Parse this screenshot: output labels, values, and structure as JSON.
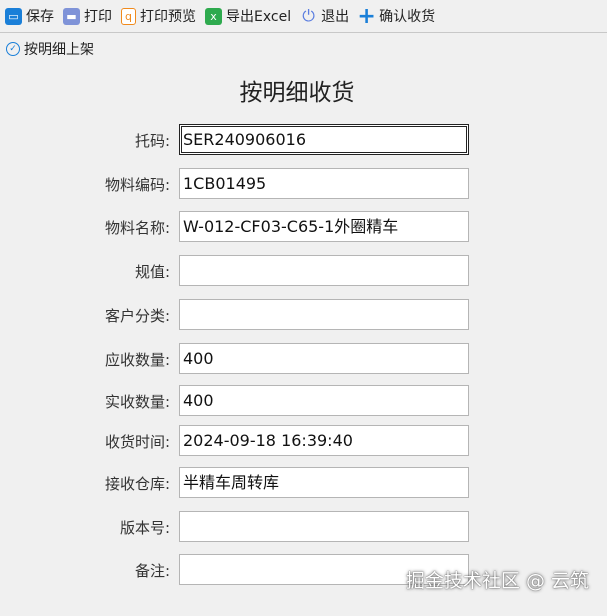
{
  "toolbar": {
    "save": "保存",
    "print": "打印",
    "preview": "打印预览",
    "export": "导出Excel",
    "exit": "退出",
    "confirm": "确认收货",
    "shelve": "按明细上架"
  },
  "title": "按明细收货",
  "fields": [
    {
      "label": "托码:",
      "value": "SER240906016"
    },
    {
      "label": "物料编码:",
      "value": "1CB01495"
    },
    {
      "label": "物料名称:",
      "value": "W-012-CF03-C65-1外圈精车"
    },
    {
      "label": "规值:",
      "value": ""
    },
    {
      "label": "客户分类:",
      "value": ""
    },
    {
      "label": "应收数量:",
      "value": "400"
    },
    {
      "label": "实收数量:",
      "value": "400"
    },
    {
      "label": "收货时间:",
      "value": "2024-09-18 16:39:40"
    },
    {
      "label": "接收仓库:",
      "value": "半精车周转库"
    },
    {
      "label": "版本号:",
      "value": ""
    },
    {
      "label": "备注:",
      "value": ""
    }
  ],
  "watermark": "掘金技术社区 @ 云筑"
}
